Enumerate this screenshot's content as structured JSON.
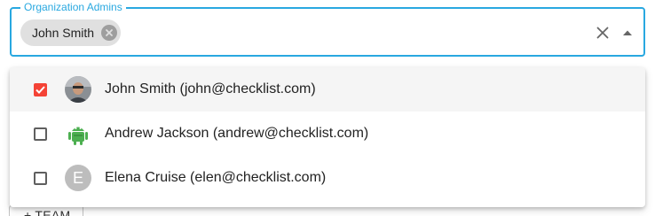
{
  "field": {
    "label": "Organization Admins",
    "accent_color": "#29a8e0"
  },
  "chip": {
    "label": "John Smith",
    "delete_icon": "cancel-circle-icon"
  },
  "controls": {
    "clear_icon": "close-icon",
    "toggle_icon": "arrow-drop-up-icon"
  },
  "options": [
    {
      "label": "John Smith (john@checklist.com)",
      "checked": true,
      "avatar": "photo",
      "avatar_icon": "user-photo-avatar"
    },
    {
      "label": "Andrew Jackson (andrew@checklist.com)",
      "checked": false,
      "avatar": "android",
      "avatar_icon": "android-robot-avatar"
    },
    {
      "label": "Elena Cruise (elen@checklist.com)",
      "checked": false,
      "avatar": "letter",
      "avatar_letter": "E"
    }
  ],
  "checkbox_color": "#f44336",
  "background_button": {
    "label": "+ TEAM"
  }
}
